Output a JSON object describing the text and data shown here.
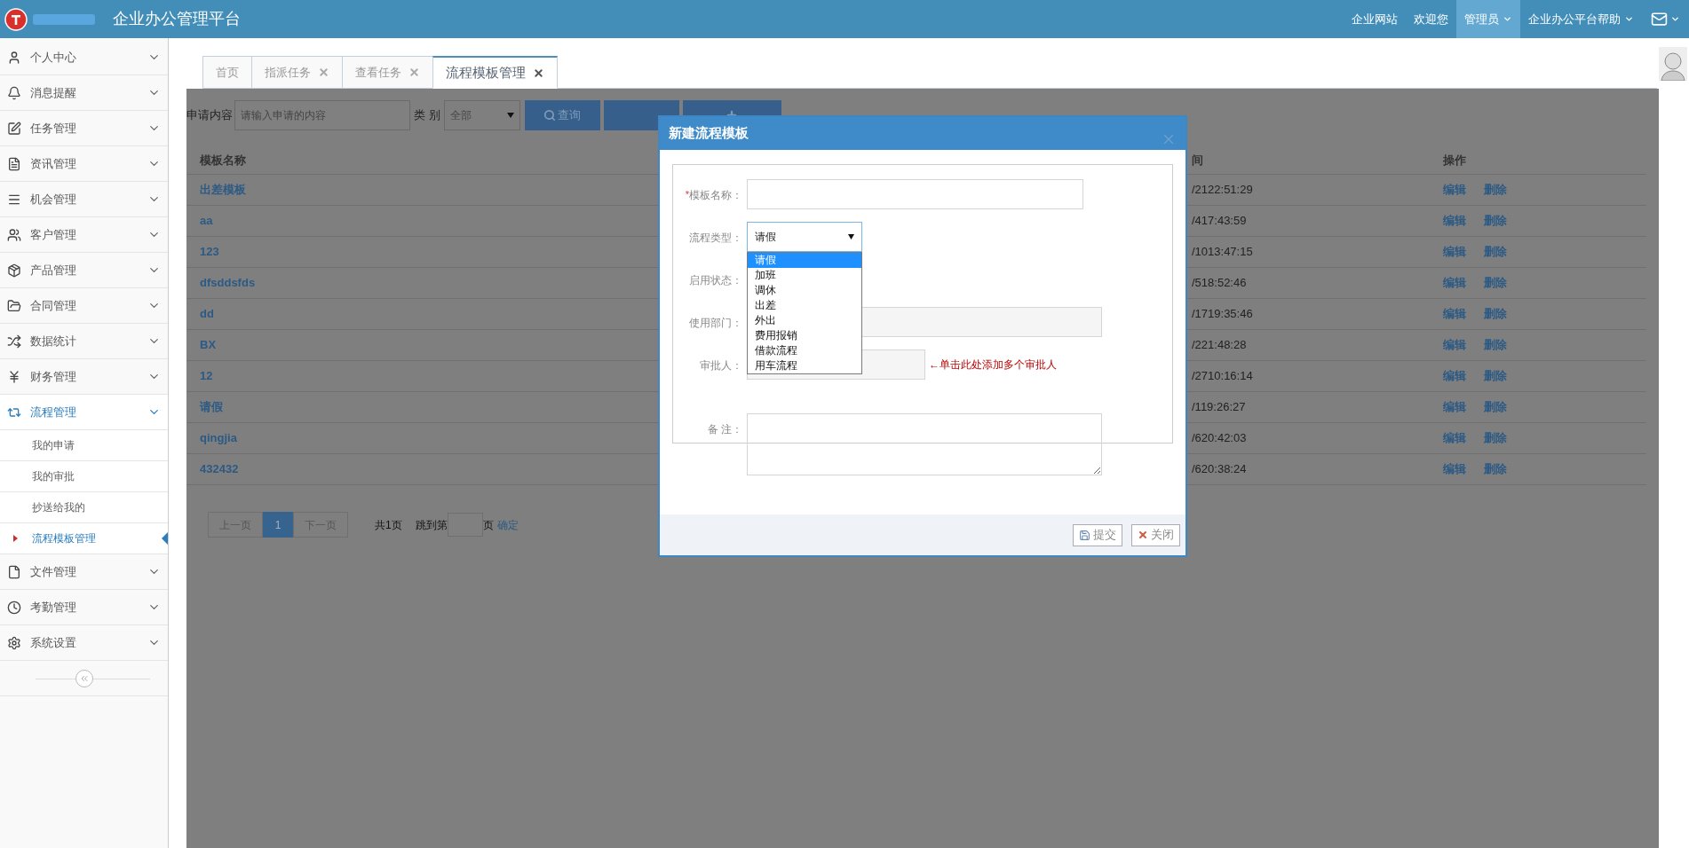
{
  "header": {
    "title": "企业办公管理平台",
    "nav": [
      {
        "label": "企业网站",
        "caret": false,
        "selected": false
      },
      {
        "label": "欢迎您",
        "caret": false,
        "selected": false
      },
      {
        "label": "管理员",
        "caret": true,
        "selected": true
      },
      {
        "label": "企业办公平台帮助",
        "caret": true,
        "selected": false
      }
    ]
  },
  "sidebar": {
    "items": [
      {
        "label": "个人中心",
        "expanded": false
      },
      {
        "label": "消息提醒",
        "expanded": false
      },
      {
        "label": "任务管理",
        "expanded": false
      },
      {
        "label": "资讯管理",
        "expanded": false
      },
      {
        "label": "机会管理",
        "expanded": false
      },
      {
        "label": "客户管理",
        "expanded": false
      },
      {
        "label": "产品管理",
        "expanded": false
      },
      {
        "label": "合同管理",
        "expanded": false
      },
      {
        "label": "数据统计",
        "expanded": false
      },
      {
        "label": "财务管理",
        "expanded": false
      },
      {
        "label": "流程管理",
        "expanded": true,
        "children": [
          {
            "label": "我的申请",
            "selected": false
          },
          {
            "label": "我的审批",
            "selected": false
          },
          {
            "label": "抄送给我的",
            "selected": false
          },
          {
            "label": "流程模板管理",
            "selected": true
          }
        ]
      },
      {
        "label": "文件管理",
        "expanded": false
      },
      {
        "label": "考勤管理",
        "expanded": false
      },
      {
        "label": "系统设置",
        "expanded": false
      }
    ]
  },
  "tabs": [
    {
      "label": "首页",
      "closable": false,
      "selected": false
    },
    {
      "label": "指派任务",
      "closable": true,
      "selected": false
    },
    {
      "label": "查看任务",
      "closable": true,
      "selected": false
    },
    {
      "label": "流程模板管理",
      "closable": true,
      "selected": true
    }
  ],
  "search": {
    "label": "申请内容",
    "placeholder": "请输入申请的内容",
    "category_label": "类 别",
    "category_value": "全部",
    "buttons": [
      {
        "kind": "search",
        "label": "查询"
      },
      {
        "kind": "blank"
      },
      {
        "kind": "add"
      }
    ]
  },
  "table": {
    "columns": [
      "模板名称",
      "间",
      "操作"
    ],
    "rows": [
      {
        "name": "出差模板",
        "time": "/2122:51:29",
        "actions": [
          "编辑",
          "删除"
        ]
      },
      {
        "name": "aa",
        "time": "/417:43:59",
        "actions": [
          "编辑",
          "删除"
        ]
      },
      {
        "name": "123",
        "time": "/1013:47:15",
        "actions": [
          "编辑",
          "删除"
        ]
      },
      {
        "name": "dfsddsfds",
        "time": "/518:52:46",
        "actions": [
          "编辑",
          "删除"
        ]
      },
      {
        "name": "dd",
        "time": "/1719:35:46",
        "actions": [
          "编辑",
          "删除"
        ]
      },
      {
        "name": "BX",
        "time": "/221:48:28",
        "actions": [
          "编辑",
          "删除"
        ]
      },
      {
        "name": "12",
        "time": "/2710:16:14",
        "actions": [
          "编辑",
          "删除"
        ]
      },
      {
        "name": "请假",
        "time": "/119:26:27",
        "actions": [
          "编辑",
          "删除"
        ]
      },
      {
        "name": "qingjia",
        "time": "/620:42:03",
        "actions": [
          "编辑",
          "删除"
        ]
      },
      {
        "name": "432432",
        "time": "/620:38:24",
        "actions": [
          "编辑",
          "删除"
        ]
      }
    ]
  },
  "pagination": {
    "prev": "上一页",
    "pages": [
      {
        "label": "1",
        "selected": true
      }
    ],
    "next": "下一页",
    "total": "共1页",
    "jump_label": "跳到第",
    "jump_suffix": "页",
    "confirm": "确定"
  },
  "modal": {
    "title": "新建流程模板",
    "fields": [
      {
        "kind": "text",
        "label": "模板名称：",
        "required_mark": "*"
      },
      {
        "kind": "select",
        "label": "流程类型：",
        "value": "请假"
      },
      {
        "kind": "status",
        "label": "启用状态："
      },
      {
        "kind": "disabled",
        "label": "使用部门："
      },
      {
        "kind": "approver",
        "label": "审批人：",
        "hint": "←单击此处添加多个审批人"
      },
      {
        "kind": "textarea",
        "label": "备 注："
      }
    ],
    "dropdown": {
      "options": [
        {
          "label": "请假",
          "selected": true
        },
        {
          "label": "加班",
          "selected": false
        },
        {
          "label": "调休",
          "selected": false
        },
        {
          "label": "出差",
          "selected": false
        },
        {
          "label": "外出",
          "selected": false
        },
        {
          "label": "费用报销",
          "selected": false
        },
        {
          "label": "借款流程",
          "selected": false
        },
        {
          "label": "用车流程",
          "selected": false
        }
      ]
    },
    "buttons": [
      {
        "kind": "save",
        "label": "提交"
      },
      {
        "kind": "close",
        "label": "关闭"
      }
    ]
  }
}
